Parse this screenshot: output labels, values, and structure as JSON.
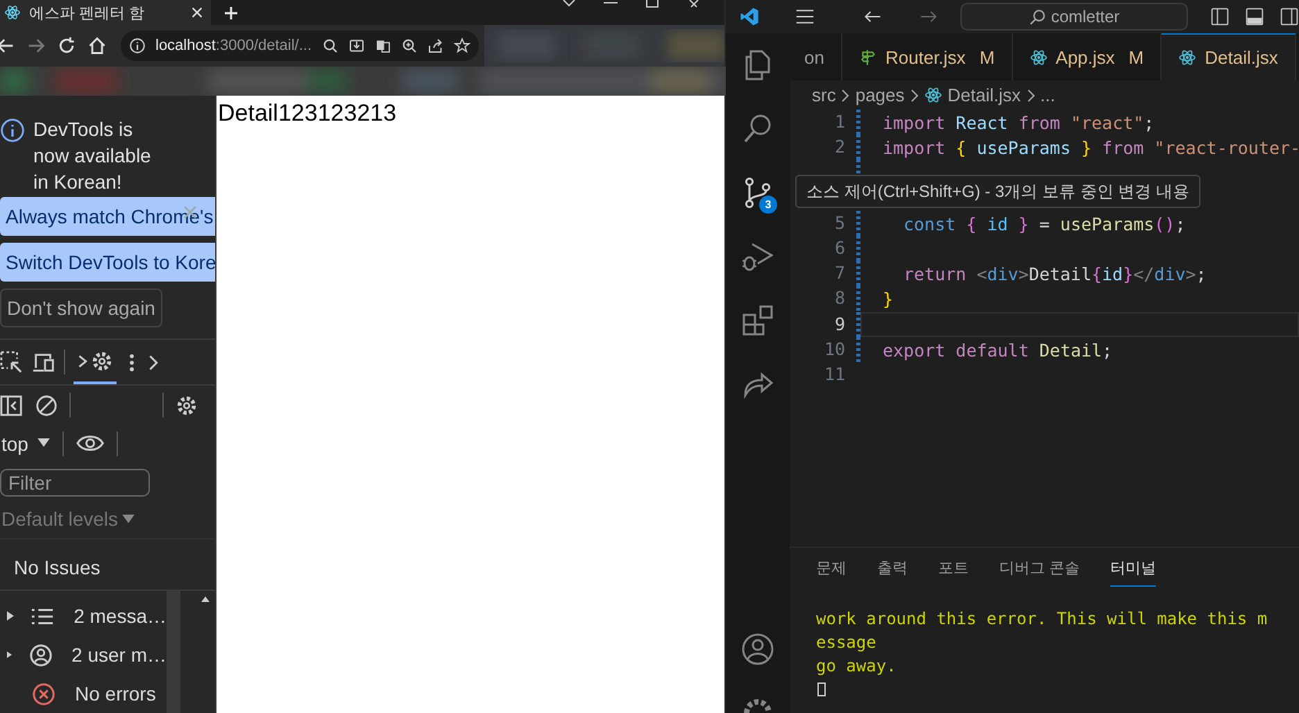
{
  "browser": {
    "tab_title": "에스파 펜레터 함",
    "address": {
      "host": "localhost",
      "rest": ":3000/detail/..."
    },
    "devtools": {
      "message": "DevTools is now available in Korean!",
      "buttons": [
        {
          "label": "Always match Chrome's",
          "kind": "primary"
        },
        {
          "label": "Switch DevTools to Kore",
          "kind": "primary"
        },
        {
          "label": "Don't show again",
          "kind": "outline"
        }
      ],
      "context": "top",
      "filter_placeholder": "Filter",
      "levels": "Default levels",
      "issues": "No Issues",
      "messages": [
        {
          "label": "2 messa…",
          "kind": "list",
          "expandable": true
        },
        {
          "label": "2 user m…",
          "kind": "user",
          "expandable": true
        },
        {
          "label": "No errors",
          "kind": "error",
          "expandable": false
        }
      ]
    },
    "page_text": "Detail123123213"
  },
  "editor": {
    "search": "comletter",
    "tabs": [
      {
        "label": "on",
        "kind": "none",
        "modified": false,
        "selected": false
      },
      {
        "label": "Router.jsx",
        "kind": "sign",
        "modified": true,
        "badge": "M",
        "selected": false
      },
      {
        "label": "App.jsx",
        "kind": "react",
        "modified": true,
        "badge": "M",
        "selected": false
      },
      {
        "label": "Detail.jsx",
        "kind": "react",
        "modified": true,
        "selected": true
      }
    ],
    "breadcrumb": [
      {
        "label": "src",
        "kind": "folder"
      },
      {
        "label": "pages",
        "kind": "folder"
      },
      {
        "label": "Detail.jsx",
        "kind": "react"
      },
      {
        "label": "...",
        "kind": "more"
      }
    ],
    "lines": [
      {
        "kind": "code",
        "number": "1",
        "added": true,
        "current": false,
        "indented": false,
        "tokens": [
          {
            "text": "import",
            "kind": "keyword"
          },
          {
            "text": " React ",
            "kind": "variable"
          },
          {
            "text": "from",
            "kind": "keyword"
          },
          {
            "text": " \"react\"",
            "kind": "string"
          },
          {
            "text": ";",
            "kind": "punct"
          }
        ]
      },
      {
        "kind": "code",
        "number": "2",
        "added": true,
        "current": false,
        "indented": false,
        "tokens": [
          {
            "text": "import",
            "kind": "keyword"
          },
          {
            "text": " { ",
            "kind": "bracket1"
          },
          {
            "text": "useParams",
            "kind": "variable"
          },
          {
            "text": " } ",
            "kind": "bracket1"
          },
          {
            "text": "from",
            "kind": "keyword"
          },
          {
            "text": " \"react-router-",
            "kind": "string"
          }
        ]
      },
      {
        "kind": "code",
        "added": true,
        "current": false
      },
      {
        "kind": "covered"
      },
      {
        "kind": "code",
        "number": "5",
        "added": true,
        "current": false,
        "indented": true,
        "tokens": [
          {
            "text": "const",
            "kind": "storage"
          },
          {
            "text": " { ",
            "kind": "bracket2"
          },
          {
            "text": "id",
            "kind": "constant"
          },
          {
            "text": " } ",
            "kind": "bracket2"
          },
          {
            "text": "= ",
            "kind": "punct"
          },
          {
            "text": "useParams",
            "kind": "function"
          },
          {
            "text": "()",
            "kind": "bracket2"
          },
          {
            "text": ";",
            "kind": "punct"
          }
        ]
      },
      {
        "kind": "code",
        "number": "6",
        "added": true,
        "current": false
      },
      {
        "kind": "code",
        "number": "7",
        "added": true,
        "current": false,
        "indented": true,
        "tokens": [
          {
            "text": "return ",
            "kind": "keyword"
          },
          {
            "text": "<",
            "kind": "tagpunct"
          },
          {
            "text": "div",
            "kind": "tag"
          },
          {
            "text": ">",
            "kind": "tagpunct"
          },
          {
            "text": "Detail",
            "kind": "punct"
          },
          {
            "text": "{",
            "kind": "bracket2"
          },
          {
            "text": "id",
            "kind": "variable"
          },
          {
            "text": "}",
            "kind": "bracket2"
          },
          {
            "text": "</",
            "kind": "tagpunct"
          },
          {
            "text": "div",
            "kind": "tag"
          },
          {
            "text": ">",
            "kind": "tagpunct"
          },
          {
            "text": ";",
            "kind": "punct"
          }
        ]
      },
      {
        "kind": "code",
        "number": "8",
        "added": true,
        "current": false,
        "indented": false,
        "tokens": [
          {
            "text": "}",
            "kind": "bracket1"
          }
        ]
      },
      {
        "kind": "code",
        "number": "9",
        "added": true,
        "current": true
      },
      {
        "kind": "code",
        "number": "10",
        "added": true,
        "current": false,
        "indented": false,
        "tokens": [
          {
            "text": "export default ",
            "kind": "keyword"
          },
          {
            "text": "Detail",
            "kind": "function"
          },
          {
            "text": ";",
            "kind": "punct"
          }
        ]
      },
      {
        "kind": "code",
        "number": "11",
        "added": false,
        "current": false
      }
    ],
    "scm_badge": "3",
    "tooltip": "소스 제어(Ctrl+Shift+G) - 3개의 보류 중인 변경 내용",
    "panel_tabs": [
      {
        "label": "문제",
        "selected": false
      },
      {
        "label": "출력",
        "selected": false
      },
      {
        "label": "포트",
        "selected": false
      },
      {
        "label": "디버그 콘솔",
        "selected": false
      },
      {
        "label": "터미널",
        "selected": true
      }
    ],
    "terminal": [
      "work around this error. This will make this m",
      "essage",
      "go away."
    ]
  }
}
